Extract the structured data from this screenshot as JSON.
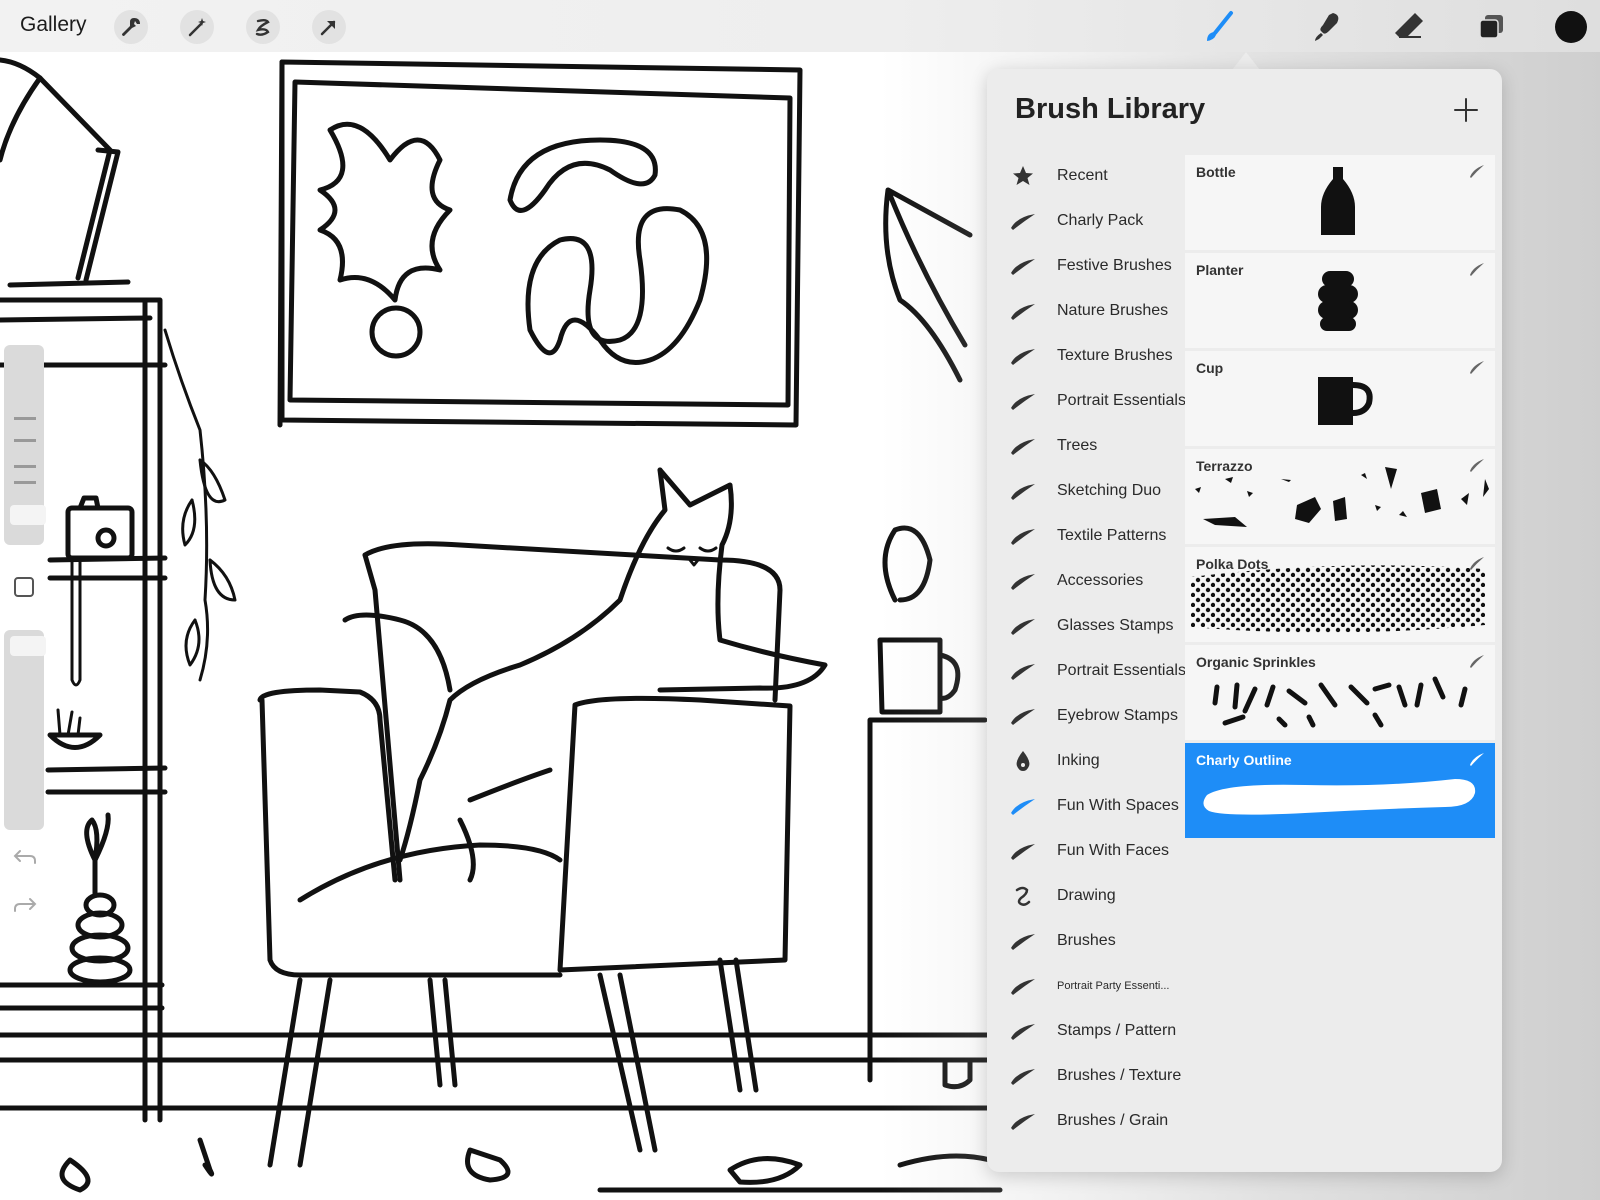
{
  "toolbar": {
    "gallery_label": "Gallery",
    "left_tools": [
      "wrench-icon",
      "magic-wand-icon",
      "selection-icon",
      "transform-arrow-icon"
    ],
    "right_tools": [
      "brush-icon",
      "smudge-icon",
      "eraser-icon",
      "layers-icon",
      "color-swatch"
    ],
    "active_tool": "brush-icon",
    "active_color": "#1e8df7",
    "current_color": "#111111"
  },
  "brush_library": {
    "title": "Brush Library",
    "add_icon": "plus-icon",
    "sets": [
      {
        "label": "Recent",
        "icon": "star-icon"
      },
      {
        "label": "Charly Pack",
        "icon": "brush-stroke-icon"
      },
      {
        "label": "Festive Brushes",
        "icon": "brush-stroke-icon"
      },
      {
        "label": "Nature Brushes",
        "icon": "brush-stroke-icon"
      },
      {
        "label": "Texture Brushes",
        "icon": "brush-stroke-icon"
      },
      {
        "label": "Portrait Essentials",
        "icon": "brush-stroke-icon"
      },
      {
        "label": "Trees",
        "icon": "brush-stroke-icon"
      },
      {
        "label": "Sketching Duo",
        "icon": "brush-stroke-icon"
      },
      {
        "label": "Textile Patterns",
        "icon": "brush-stroke-icon"
      },
      {
        "label": "Accessories",
        "icon": "brush-stroke-icon"
      },
      {
        "label": "Glasses Stamps",
        "icon": "brush-stroke-icon"
      },
      {
        "label": "Portrait Essentials",
        "icon": "brush-stroke-icon"
      },
      {
        "label": "Eyebrow Stamps",
        "icon": "brush-stroke-icon"
      },
      {
        "label": "Inking",
        "icon": "ink-drop-icon"
      },
      {
        "label": "Fun With Spaces",
        "icon": "brush-stroke-icon",
        "selected": true
      },
      {
        "label": "Fun With Faces",
        "icon": "brush-stroke-icon"
      },
      {
        "label": "Drawing",
        "icon": "squiggle-icon"
      },
      {
        "label": "Brushes",
        "icon": "brush-stroke-icon"
      },
      {
        "label": "Portrait Party Essenti...",
        "icon": "brush-stroke-icon"
      },
      {
        "label": "Stamps / Pattern",
        "icon": "brush-stroke-icon"
      },
      {
        "label": "Brushes / Texture",
        "icon": "brush-stroke-icon"
      },
      {
        "label": "Brushes / Grain",
        "icon": "brush-stroke-icon"
      }
    ],
    "brushes": [
      {
        "name": "Bottle",
        "preview": "bottle-stamp"
      },
      {
        "name": "Planter",
        "preview": "planter-stamp"
      },
      {
        "name": "Cup",
        "preview": "cup-stamp"
      },
      {
        "name": "Terrazzo",
        "preview": "terrazzo-pattern"
      },
      {
        "name": "Polka Dots",
        "preview": "polka-dot-pattern"
      },
      {
        "name": "Organic Sprinkles",
        "preview": "sprinkles-pattern"
      },
      {
        "name": "Charly Outline",
        "preview": "outline-stroke",
        "selected": true
      }
    ]
  },
  "sidebar": {
    "undo_icon": "undo-icon",
    "redo_icon": "redo-icon",
    "modify_icon": "square-modify-icon"
  }
}
